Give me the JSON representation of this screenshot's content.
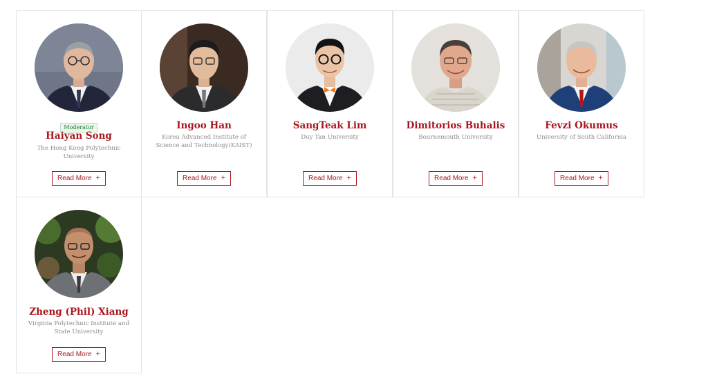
{
  "speakers": [
    {
      "badge": "Moderator",
      "name": "Haiyan Song",
      "affiliation": "The Hong Kong Polytechnic University",
      "button": "Read More",
      "plus": "+"
    },
    {
      "badge": "",
      "name": "Ingoo Han",
      "affiliation": "Korea Advanced Institute of Science and Technology(KAIST)",
      "button": "Read More",
      "plus": "+"
    },
    {
      "badge": "",
      "name": "SangTeak Lim",
      "affiliation": "Duy Tan University",
      "button": "Read More",
      "plus": "+"
    },
    {
      "badge": "",
      "name": "Dimitorios Buhalis",
      "affiliation": "Bournemouth University",
      "button": "Read More",
      "plus": "+"
    },
    {
      "badge": "",
      "name": "Fevzi Okumus",
      "affiliation": "University of South California",
      "button": "Read More",
      "plus": "+"
    },
    {
      "badge": "",
      "name": "Zheng (Phil) Xiang",
      "affiliation": "Virginia Polytechnic Institute and State University",
      "button": "Read More",
      "plus": "+"
    }
  ],
  "colors": {
    "accent": "#a8171e",
    "badge_text": "#1f7a2e",
    "muted": "#8a8a8a"
  }
}
